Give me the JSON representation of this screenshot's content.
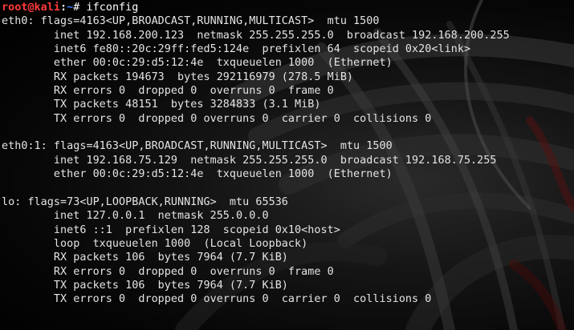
{
  "prompt": {
    "user_host": "root@kali",
    "separator": ":",
    "path": "~",
    "symbol": "# ",
    "command": "ifconfig"
  },
  "output_lines": [
    "eth0: flags=4163<UP,BROADCAST,RUNNING,MULTICAST>  mtu 1500",
    "        inet 192.168.200.123  netmask 255.255.255.0  broadcast 192.168.200.255",
    "        inet6 fe80::20c:29ff:fed5:124e  prefixlen 64  scopeid 0x20<link>",
    "        ether 00:0c:29:d5:12:4e  txqueuelen 1000  (Ethernet)",
    "        RX packets 194673  bytes 292116979 (278.5 MiB)",
    "        RX errors 0  dropped 0  overruns 0  frame 0",
    "        TX packets 48151  bytes 3284833 (3.1 MiB)",
    "        TX errors 0  dropped 0 overruns 0  carrier 0  collisions 0",
    "",
    "eth0:1: flags=4163<UP,BROADCAST,RUNNING,MULTICAST>  mtu 1500",
    "        inet 192.168.75.129  netmask 255.255.255.0  broadcast 192.168.75.255",
    "        ether 00:0c:29:d5:12:4e  txqueuelen 1000  (Ethernet)",
    "",
    "lo: flags=73<UP,LOOPBACK,RUNNING>  mtu 65536",
    "        inet 127.0.0.1  netmask 255.0.0.0",
    "        inet6 ::1  prefixlen 128  scopeid 0x10<host>",
    "        loop  txqueuelen 1000  (Local Loopback)",
    "        RX packets 106  bytes 7964 (7.7 KiB)",
    "        RX errors 0  dropped 0  overruns 0  frame 0",
    "        TX packets 106  bytes 7964 (7.7 KiB)",
    "        TX errors 0  dropped 0 overruns 0  carrier 0  collisions 0"
  ],
  "colors": {
    "background": "#000000",
    "text": "#e4e4e4",
    "prompt_user": "#ff3b3b",
    "prompt_path": "#3c7bff"
  }
}
